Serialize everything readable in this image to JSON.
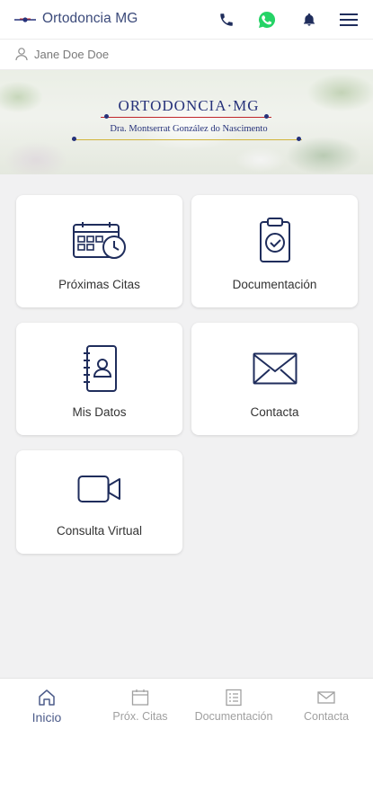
{
  "app": {
    "title": "Ortodoncia MG"
  },
  "user": {
    "name": "Jane Doe Doe"
  },
  "banner": {
    "brand_name": "ORTODONCIA·MG",
    "brand_subtitle": "Dra. Montserrat González do Nascimento"
  },
  "header_icons": [
    "phone-icon",
    "whatsapp-icon",
    "bell-icon",
    "menu-icon"
  ],
  "cards": [
    {
      "label": "Próximas Citas",
      "icon": "calendar-clock-icon"
    },
    {
      "label": "Documentación",
      "icon": "clipboard-check-icon"
    },
    {
      "label": "Mis Datos",
      "icon": "contact-book-icon"
    },
    {
      "label": "Contacta",
      "icon": "envelope-icon"
    },
    {
      "label": "Consulta Virtual",
      "icon": "video-camera-icon"
    }
  ],
  "bottom_nav": [
    {
      "label": "Inicio",
      "icon": "home-icon",
      "active": true
    },
    {
      "label": "Próx. Citas",
      "icon": "calendar-icon",
      "active": false
    },
    {
      "label": "Documentación",
      "icon": "document-list-icon",
      "active": false
    },
    {
      "label": "Contacta",
      "icon": "mail-icon",
      "active": false
    }
  ],
  "colors": {
    "accent": "#26327a",
    "whatsapp": "#25d366",
    "icon_navy": "#1f2d5c",
    "inactive_nav": "#a0a0a0",
    "background": "#f1f1f2"
  }
}
